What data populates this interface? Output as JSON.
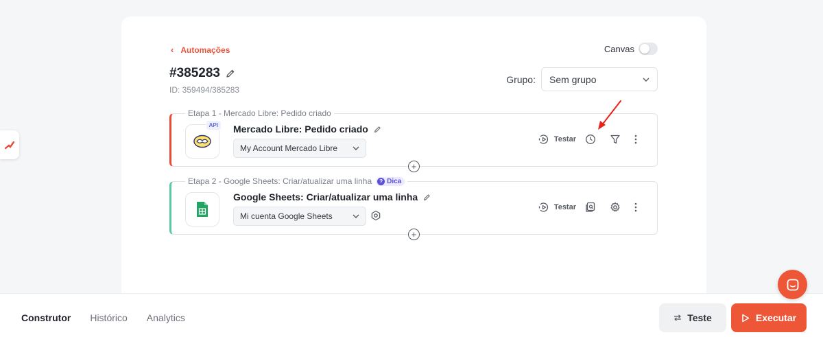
{
  "nav": {
    "back_label": "Automações"
  },
  "header": {
    "title": "#385283",
    "id_line": "ID: 359494/385283"
  },
  "canvas": {
    "label": "Canvas",
    "enabled": false
  },
  "grupo": {
    "label": "Grupo:",
    "value": "Sem grupo"
  },
  "steps": [
    {
      "legend": "Etapa 1 - Mercado Libre: Pedido criado",
      "name": "Mercado Libre: Pedido criado",
      "badge": "API",
      "account": "My Account Mercado Libre",
      "test_label": "Testar",
      "accent": "#e84a36"
    },
    {
      "legend": "Etapa 2 - Google Sheets: Criar/atualizar uma linha",
      "tip": "Dica",
      "name": "Google Sheets: Criar/atualizar uma linha",
      "account": "Mi cuenta Google Sheets",
      "test_label": "Testar",
      "accent": "#5ac8a0"
    }
  ],
  "footer": {
    "tabs": [
      "Construtor",
      "Histórico",
      "Analytics"
    ],
    "active_tab": "Construtor",
    "test_button": "Teste",
    "run_button": "Executar"
  },
  "colors": {
    "brand": "#ee5638",
    "accent_red": "#e84a36",
    "accent_green": "#5ac8a0"
  }
}
